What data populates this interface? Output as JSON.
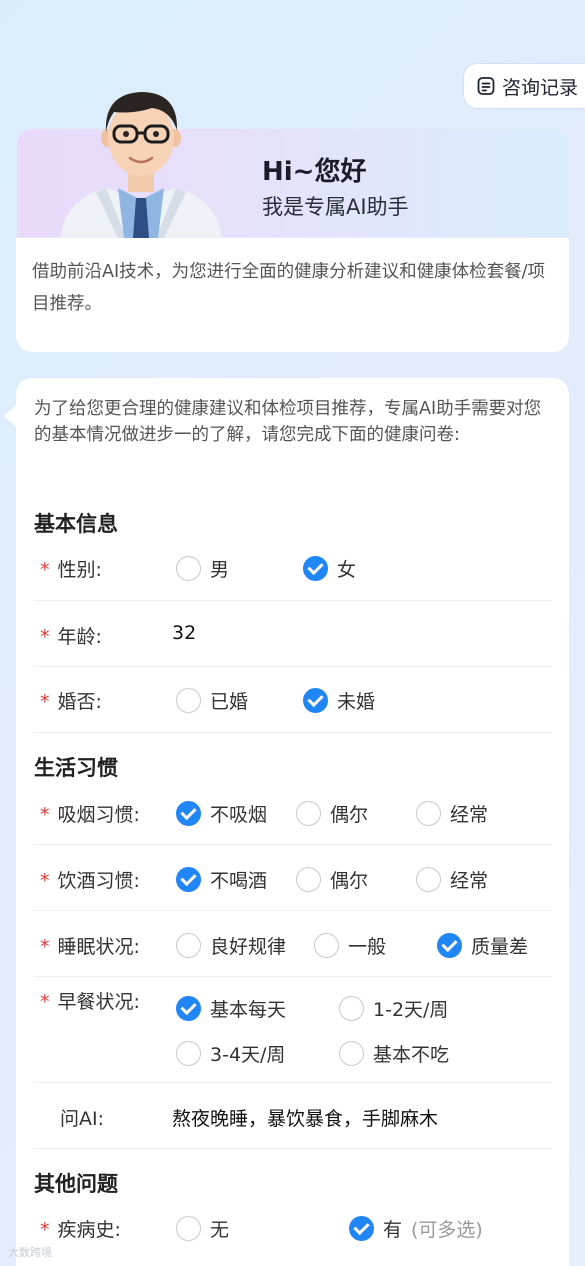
{
  "header": {
    "history_label": "咨询记录"
  },
  "hero": {
    "greeting": "Hi~您好",
    "subtitle": "我是专属AI助手",
    "description": "借助前沿AI技术，为您进行全面的健康分析建议和健康体检套餐/项目推荐。"
  },
  "questionnaire": {
    "intro": "为了给您更合理的健康建议和体检项目推荐，专属AI助手需要对您的基本情况做进步一的了解，请您完成下面的健康问卷:",
    "sections": {
      "basic": "基本信息",
      "habits": "生活习惯",
      "other": "其他问题"
    },
    "required_mark": "*",
    "gender": {
      "label": "性别:",
      "options": [
        "男",
        "女"
      ],
      "selected": "女"
    },
    "age": {
      "label": "年龄:",
      "value": "32"
    },
    "marital": {
      "label": "婚否:",
      "options": [
        "已婚",
        "未婚"
      ],
      "selected": "未婚"
    },
    "smoking": {
      "label": "吸烟习惯:",
      "options": [
        "不吸烟",
        "偶尔",
        "经常"
      ],
      "selected": "不吸烟"
    },
    "drinking": {
      "label": "饮酒习惯:",
      "options": [
        "不喝酒",
        "偶尔",
        "经常"
      ],
      "selected": "不喝酒"
    },
    "sleep": {
      "label": "睡眠状况:",
      "options": [
        "良好规律",
        "一般",
        "质量差"
      ],
      "selected": "质量差"
    },
    "breakfast": {
      "label": "早餐状况:",
      "options": [
        "基本每天",
        "1-2天/周",
        "3-4天/周",
        "基本不吃"
      ],
      "selected": "基本每天"
    },
    "ask_ai": {
      "label": "问AI:",
      "value": "熬夜晚睡，暴饮暴食，手脚麻木"
    },
    "disease": {
      "label": "疾病史:",
      "options": [
        "无",
        "有"
      ],
      "hint": "(可多选)",
      "selected": "有"
    }
  },
  "watermark": "大数跨境"
}
